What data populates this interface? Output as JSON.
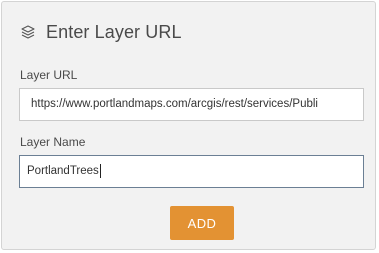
{
  "header": {
    "icon": "layers-icon",
    "title": "Enter Layer URL"
  },
  "layer_url": {
    "label": "Layer URL",
    "value": "https://www.portlandmaps.com/arcgis/rest/services/Publi"
  },
  "layer_name": {
    "label": "Layer Name",
    "value": "PortlandTrees"
  },
  "add_button": {
    "label": "ADD"
  },
  "colors": {
    "accent": "#e39233",
    "panel_background": "#f2f2f2",
    "text": "#4a4a4a"
  }
}
